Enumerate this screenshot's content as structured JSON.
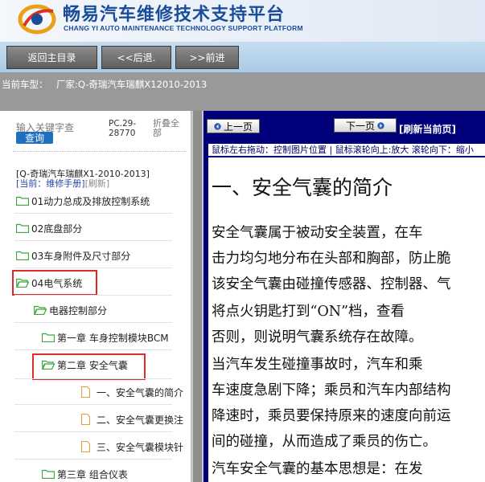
{
  "header": {
    "title": "畅易汽车维修技术支持平台",
    "subtitle": "CHANG YI AUTO MAINTENANCE TECHNOLOGY SUPPORT PLATFORM"
  },
  "nav": {
    "home": "返回主目录",
    "back": "<<后退.",
    "forward": ">>前进"
  },
  "vehicle": {
    "label": "当前车型：",
    "value": "厂家:Q-奇瑞汽车瑞麒X12010-2013"
  },
  "sidebar": {
    "search_placeholder": "输入关键字查",
    "search_button": "查询",
    "pc_code": "PC.29-28770",
    "collapse_all": "折叠全部",
    "doc_vehicle": "[Q-奇瑞汽车瑞麒X1-2010-2013]",
    "doc_current": "[当前：维修手册]",
    "doc_refresh": "[刷新]",
    "tree": [
      {
        "label": "01动力总成及排放控制系统",
        "type": "folder"
      },
      {
        "label": "02底盘部分",
        "type": "folder"
      },
      {
        "label": "03车身附件及尺寸部分",
        "type": "folder"
      },
      {
        "label": "04电气系统",
        "type": "folder-open",
        "highlighted": true
      },
      {
        "label": "电器控制部分",
        "type": "folder-open"
      },
      {
        "label": "第一章 车身控制模块BCM",
        "type": "folder"
      },
      {
        "label": "第二章 安全气囊",
        "type": "folder-open",
        "highlighted": true
      },
      {
        "label": "一、安全气囊的简介",
        "type": "page"
      },
      {
        "label": "二、安全气囊更换注",
        "type": "page"
      },
      {
        "label": "三、安全气囊模块针",
        "type": "page"
      },
      {
        "label": "第三章 组合仪表",
        "type": "folder"
      }
    ]
  },
  "viewer": {
    "prev": "上一页",
    "next": "下一页",
    "refresh": "[刷新当前页]",
    "hint": "鼠标左右拖动：控制图片位置 | 鼠标滚轮向上:放大   滚轮向下：缩小",
    "doc_title": "一、安全气囊的简介",
    "lines": [
      "    安全气囊属于被动安全装置，在车",
      "击力均匀地分布在头部和胸部，防止脆",
      "该安全气囊由碰撞传感器、控制器、气",
      "    将点火钥匙打到“ON”档，查看",
      "否则，则说明气囊系统存在故障。",
      "    当汽车发生碰撞事故时，汽车和乘",
      "车速度急剧下降；乘员和汽车内部结构",
      "降速时，乘员要保持原来的速度向前运",
      "间的碰撞，从而造成了乘员的伤亡。",
      "    汽车安全气囊的基本思想是：在发"
    ]
  },
  "colors": {
    "brand_blue": "#1a4d99",
    "highlight_red": "#e02a2a",
    "viewer_bg": "#00007a",
    "model_bar": "#999999"
  }
}
